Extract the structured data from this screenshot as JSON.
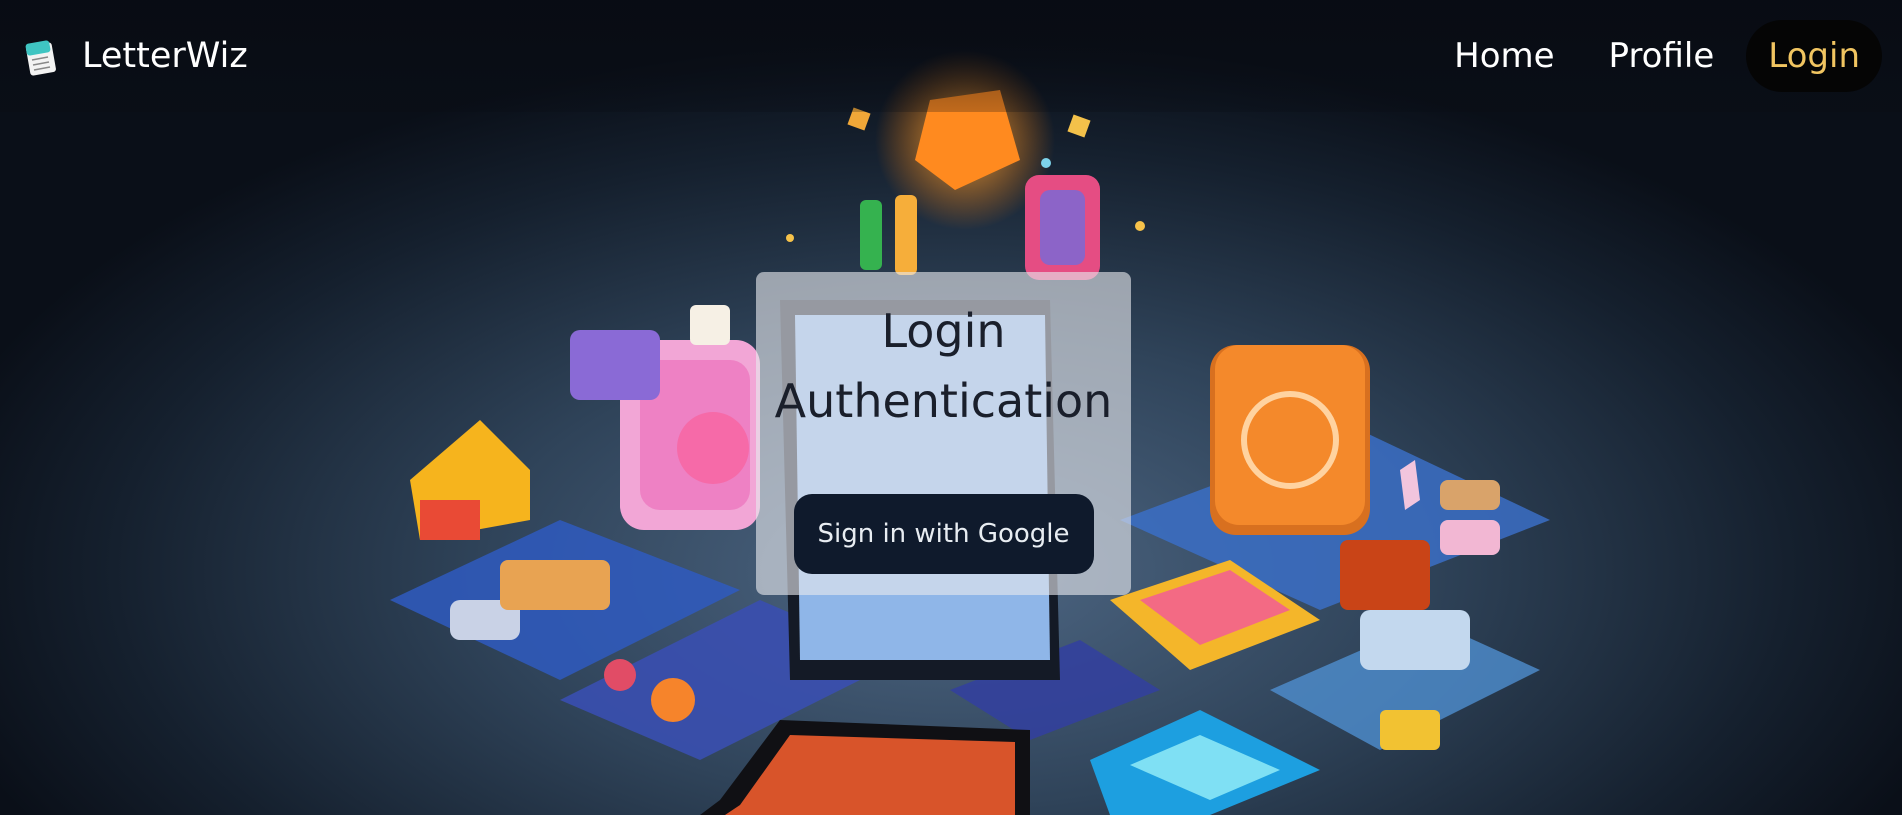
{
  "brand": {
    "name": "LetterWiz",
    "icon": "notepad-icon"
  },
  "nav": {
    "items": [
      {
        "label": "Home",
        "active": false
      },
      {
        "label": "Profile",
        "active": false
      },
      {
        "label": "Login",
        "active": true
      }
    ],
    "active_color": "#f1c561"
  },
  "card": {
    "title_line1": "Login",
    "title_line2": "Authentication",
    "google_button_label": "Sign in with Google"
  },
  "background": {
    "description_icon": "isometric-apps-illustration"
  }
}
